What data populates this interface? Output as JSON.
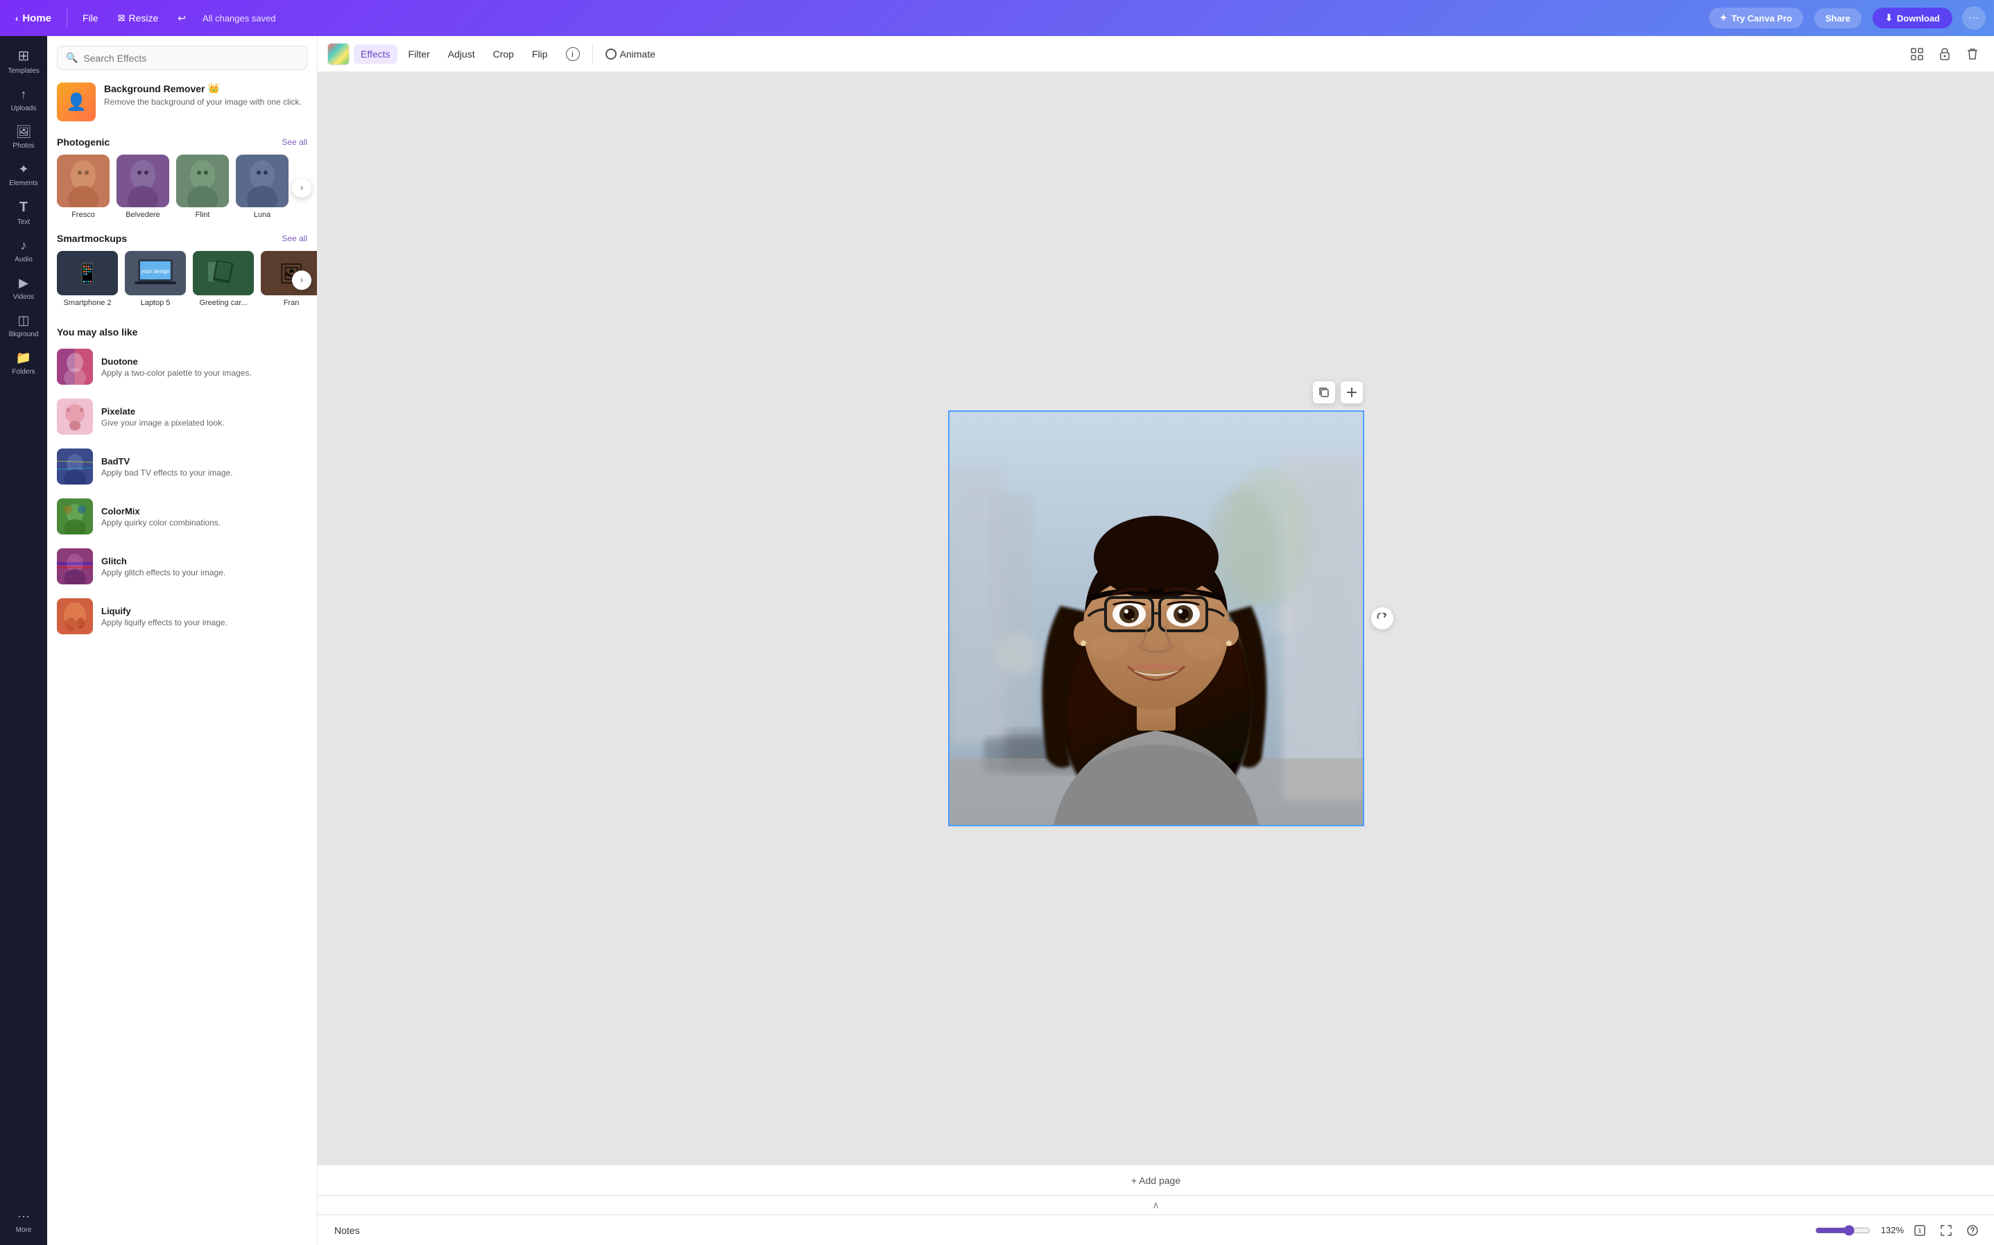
{
  "topbar": {
    "home_label": "Home",
    "file_label": "File",
    "resize_label": "Resize",
    "saved_label": "All changes saved",
    "try_pro_label": "Try Canva Pro",
    "share_label": "Share",
    "download_label": "Download"
  },
  "sidebar": {
    "items": [
      {
        "id": "templates",
        "label": "Templates",
        "icon": "⊞"
      },
      {
        "id": "uploads",
        "label": "Uploads",
        "icon": "↑"
      },
      {
        "id": "photos",
        "label": "Photos",
        "icon": "🖼"
      },
      {
        "id": "elements",
        "label": "Elements",
        "icon": "✦"
      },
      {
        "id": "text",
        "label": "Text",
        "icon": "T"
      },
      {
        "id": "audio",
        "label": "Audio",
        "icon": "♪"
      },
      {
        "id": "videos",
        "label": "Videos",
        "icon": "▶"
      },
      {
        "id": "background",
        "label": "Bkground",
        "icon": "◫"
      },
      {
        "id": "folders",
        "label": "Folders",
        "icon": "📁"
      },
      {
        "id": "more",
        "label": "More",
        "icon": "···"
      }
    ]
  },
  "effects_panel": {
    "search_placeholder": "Search Effects",
    "bg_remover": {
      "title": "Background Remover",
      "description": "Remove the background of your image with one click."
    },
    "photogenic": {
      "section_title": "Photogenic",
      "see_all": "See all",
      "items": [
        {
          "name": "Fresco",
          "color": "thumb-fresco"
        },
        {
          "name": "Belvedere",
          "color": "thumb-belvedere"
        },
        {
          "name": "Flint",
          "color": "thumb-flint"
        },
        {
          "name": "Luna",
          "color": "thumb-luna"
        }
      ]
    },
    "smartmockups": {
      "section_title": "Smartmockups",
      "see_all": "See all",
      "items": [
        {
          "name": "Smartphone 2",
          "color": "mock-smartphone",
          "icon": "📱"
        },
        {
          "name": "Laptop 5",
          "color": "mock-laptop",
          "icon": "💻"
        },
        {
          "name": "Greeting car...",
          "color": "mock-greeting",
          "icon": "📋"
        },
        {
          "name": "Fran",
          "color": "mock-fran",
          "icon": "🖼"
        }
      ]
    },
    "may_also_like": {
      "section_title": "You may also like",
      "items": [
        {
          "id": "duotone",
          "name": "Duotone",
          "description": "Apply a two-color palette to your images.",
          "color": "thumb-duotone",
          "emoji": "👤"
        },
        {
          "id": "pixelate",
          "name": "Pixelate",
          "description": "Give your image a pixelated look.",
          "color": "thumb-pixelate",
          "emoji": "🍩"
        },
        {
          "id": "badtv",
          "name": "BadTV",
          "description": "Apply bad TV effects to your image.",
          "color": "thumb-badtv",
          "emoji": "👤"
        },
        {
          "id": "colormix",
          "name": "ColorMix",
          "description": "Apply quirky color combinations.",
          "color": "thumb-colormix",
          "emoji": "🌿"
        },
        {
          "id": "glitch",
          "name": "Glitch",
          "description": "Apply glitch effects to your image.",
          "color": "thumb-glitch",
          "emoji": "👤"
        },
        {
          "id": "liquify",
          "name": "Liquify",
          "description": "Apply liquify effects to your image.",
          "color": "thumb-liquify",
          "emoji": "🌸"
        }
      ]
    }
  },
  "toolbar": {
    "effects_label": "Effects",
    "filter_label": "Filter",
    "adjust_label": "Adjust",
    "crop_label": "Crop",
    "flip_label": "Flip",
    "animate_label": "Animate"
  },
  "canvas": {
    "add_page_label": "+ Add page",
    "notes_label": "Notes",
    "zoom_value": "132%",
    "page_number": "1"
  }
}
